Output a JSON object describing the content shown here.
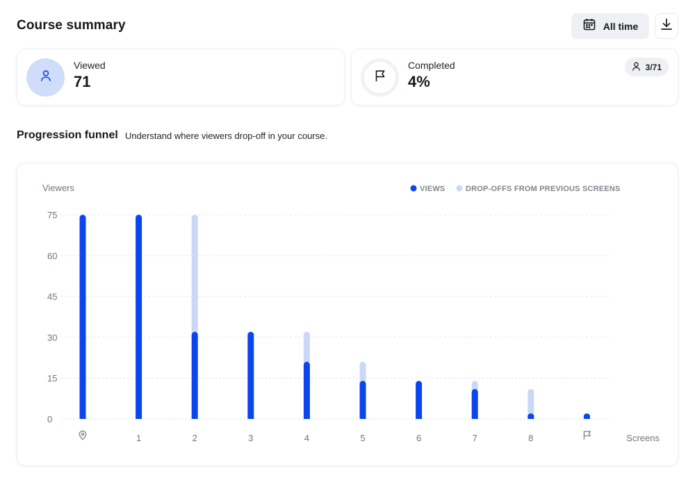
{
  "header": {
    "title": "Course summary",
    "time_filter": "All time",
    "calendar_icon": "calendar-icon",
    "download_icon": "download-icon"
  },
  "stats": {
    "viewed": {
      "label": "Viewed",
      "value": "71",
      "icon": "user-icon"
    },
    "completed": {
      "label": "Completed",
      "value": "4%",
      "icon": "flag-icon",
      "ratio": "3/71"
    }
  },
  "section": {
    "title": "Progression funnel",
    "subtitle": "Understand where viewers drop-off in your course."
  },
  "colors": {
    "views": "#0a45f0",
    "dropoffs": "#cad8f7",
    "accent_light": "#cfdcfa"
  },
  "chart_data": {
    "type": "bar",
    "ylabel": "Viewers",
    "xlabel": "Screens",
    "ylim": [
      0,
      75
    ],
    "yticks": [
      0,
      15,
      30,
      45,
      60,
      75
    ],
    "grid": true,
    "legend_position": "top-right",
    "categories": [
      "start",
      "1",
      "2",
      "3",
      "4",
      "5",
      "6",
      "7",
      "8",
      "finish"
    ],
    "category_icons": {
      "start": "location-pin-icon",
      "finish": "flag-icon"
    },
    "series": [
      {
        "name": "VIEWS",
        "values": [
          75,
          75,
          32,
          32,
          21,
          14,
          14,
          11,
          2,
          2
        ]
      },
      {
        "name": "DROP-OFFS FROM PREVIOUS SCREENS",
        "values": [
          0,
          0,
          43,
          0,
          11,
          7,
          0,
          3,
          9,
          0
        ]
      }
    ]
  }
}
